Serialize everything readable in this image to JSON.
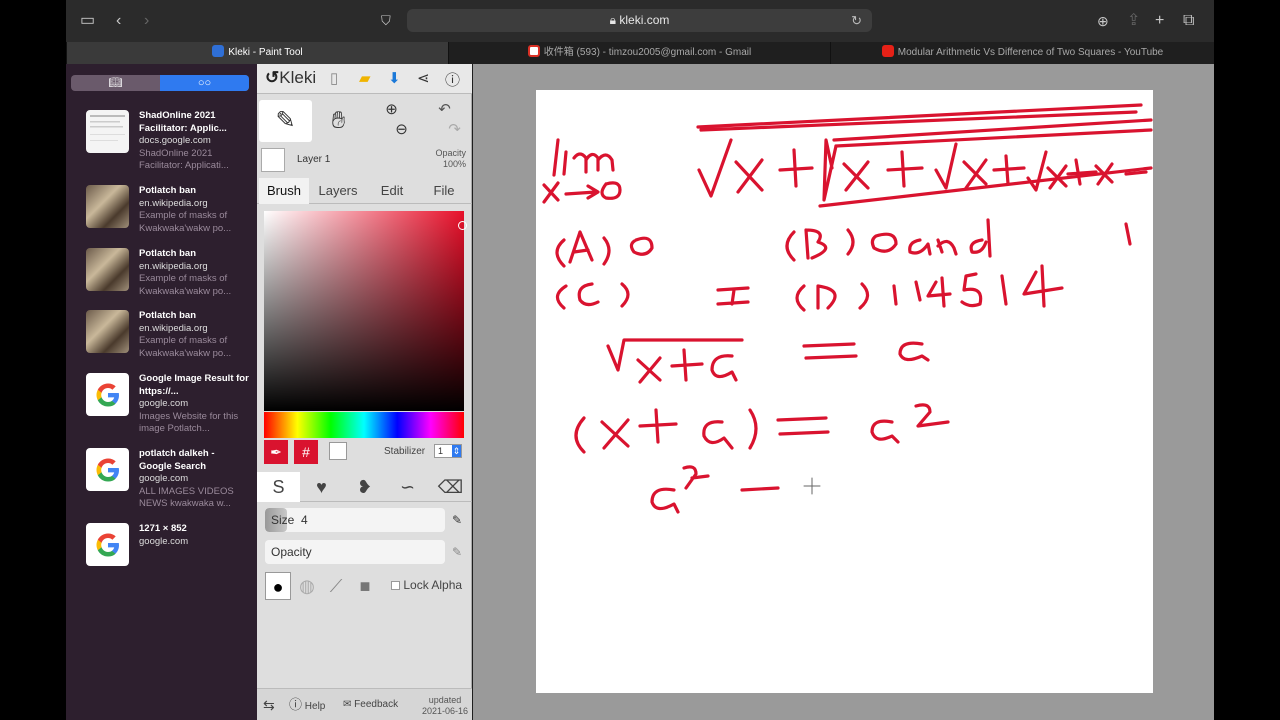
{
  "browser": {
    "url": "kleki.com",
    "tabs": [
      {
        "label": "Kleki - Paint Tool",
        "active": true
      },
      {
        "label": "收件箱 (593) - timzou2005@gmail.com - Gmail",
        "active": false
      },
      {
        "label": "Modular Arithmetic Vs Difference of Two Squares - YouTube",
        "active": false
      }
    ]
  },
  "sidebar": {
    "items": [
      {
        "title": "ShadOnline 2021 Facilitator: Applic...",
        "domain": "docs.google.com",
        "desc": "ShadOnline 2021 Facilitator: Applicati..."
      },
      {
        "title": "Potlatch ban",
        "domain": "en.wikipedia.org",
        "desc": "Example of masks of Kwakwaka'wakw po..."
      },
      {
        "title": "Potlatch ban",
        "domain": "en.wikipedia.org",
        "desc": "Example of masks of Kwakwaka'wakw po..."
      },
      {
        "title": "Potlatch ban",
        "domain": "en.wikipedia.org",
        "desc": "Example of masks of Kwakwaka'wakw po..."
      },
      {
        "title": "Google Image Result for https://...",
        "domain": "google.com",
        "desc": "Images Website for this image Potlatch..."
      },
      {
        "title": "potlatch dalkeh - Google Search",
        "domain": "google.com",
        "desc": "ALL IMAGES VIDEOS NEWS kwakwaka w..."
      },
      {
        "title": "1271 × 852",
        "domain": "google.com",
        "desc": ""
      }
    ]
  },
  "kleki": {
    "logo": "Kleki",
    "layer_name": "Layer 1",
    "opacity_label": "Opacity",
    "opacity_value": "100%",
    "tabs": [
      "Brush",
      "Layers",
      "Edit",
      "File"
    ],
    "hash": "#",
    "stabilizer_label": "Stabilizer",
    "stabilizer_value": "1",
    "size_label": "Size",
    "size_value": "4",
    "size_fraction": 0.12,
    "opacity_slider_label": "Opacity",
    "opacity_slider_value": "100",
    "opacity_fraction": 1.0,
    "lock_alpha": "Lock Alpha",
    "footer": {
      "help": "Help",
      "feedback": "Feedback",
      "updated_label": "updated",
      "updated_date": "2021-06-16"
    },
    "colors": {
      "primary": "#d9132f"
    }
  },
  "canvas": {
    "ink_color": "#d9132f"
  }
}
